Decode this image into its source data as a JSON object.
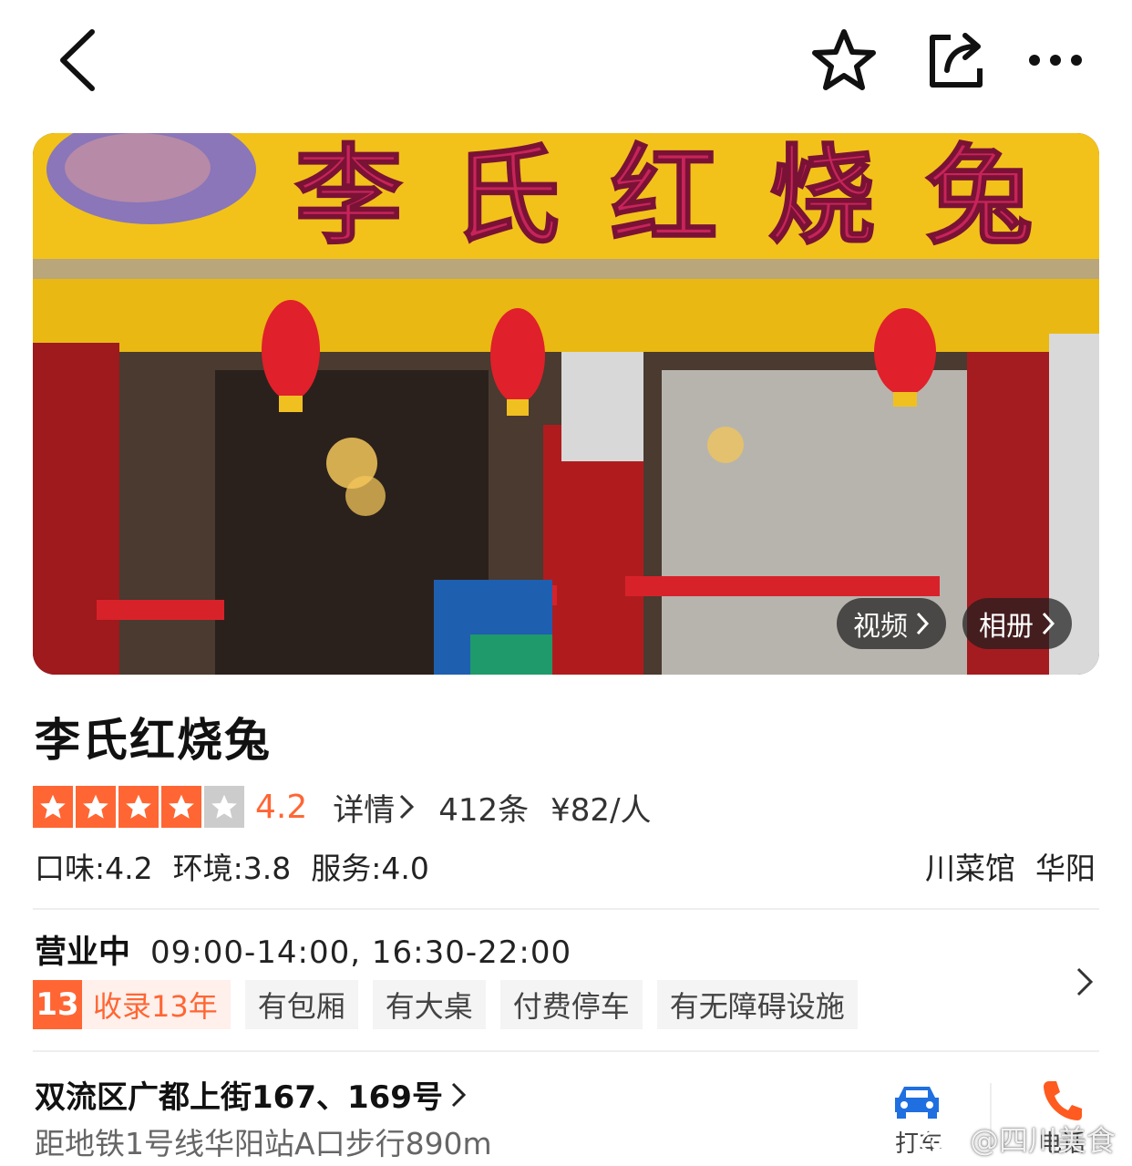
{
  "shop": {
    "name": "李氏红烧兔",
    "sign_text": "李氏红烧兔",
    "rating": 4.2,
    "rating_text": "4.2",
    "stars_filled": 4,
    "stars_total": 5,
    "detail_label": "详情",
    "review_count": "412条",
    "price": "¥82/人",
    "taste": "口味:4.2",
    "environment": "环境:3.8",
    "service": "服务:4.0",
    "category": "川菜馆",
    "area": "华阳"
  },
  "media": {
    "video_label": "视频",
    "album_label": "相册"
  },
  "hours": {
    "status": "营业中",
    "time": "09:00-14:00, 16:30-22:00"
  },
  "tags": {
    "years_badge": "13",
    "years_label": "收录13年",
    "items": [
      "有包厢",
      "有大桌",
      "付费停车",
      "有无障碍设施"
    ]
  },
  "address": {
    "street": "双流区广都上街167、169号",
    "metro": "距地铁1号线华阳站A口步行890m"
  },
  "actions": {
    "taxi_label": "打车",
    "call_label": "电话"
  },
  "watermark": "@四川美食",
  "colors": {
    "accent": "#ff6633",
    "taxi_blue": "#1f6fe0",
    "call_orange": "#ff5a1f"
  }
}
